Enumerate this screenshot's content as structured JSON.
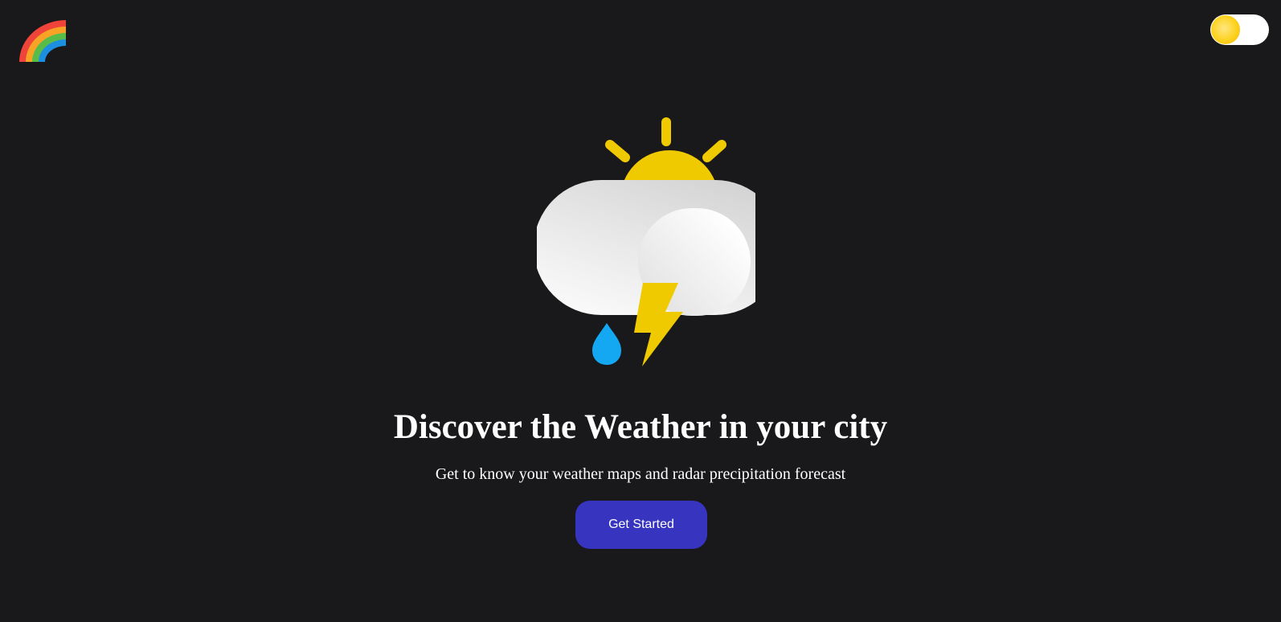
{
  "header": {
    "logo_icon": "rainbow-icon",
    "theme_toggle": {
      "icon": "sun-icon",
      "knob_color": "#fcd21f",
      "track_color": "#ffffff"
    }
  },
  "hero": {
    "illustration_icon": "thunderstorm-sun-icon",
    "title": "Discover the Weather in your city",
    "subtitle": "Get to know your weather maps and radar precipitation forecast",
    "cta_label": "Get Started"
  },
  "colors": {
    "background": "#19191b",
    "accent": "#3734c0",
    "sun": "#f0ca00",
    "raindrop": "#15a8f2"
  }
}
